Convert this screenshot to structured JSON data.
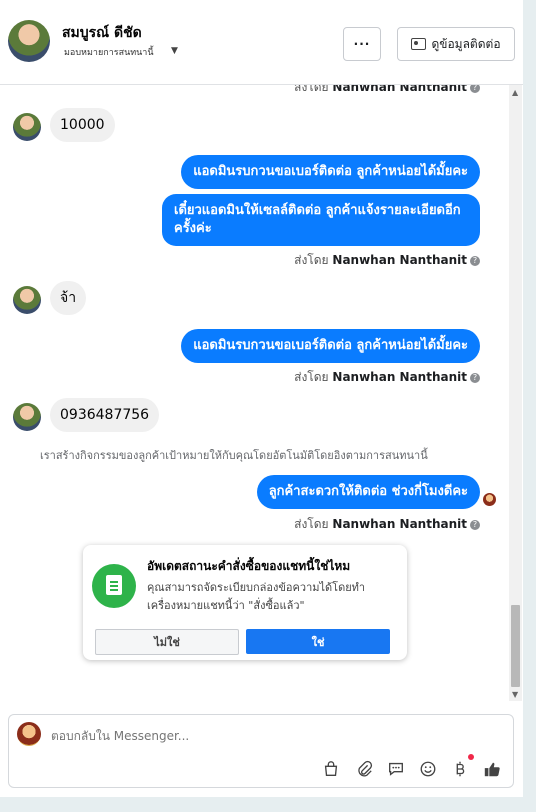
{
  "header": {
    "contact_name": "สมบูรณ์ ดีชัด",
    "assign_label": "มอบหมายการสนทนานี้",
    "more_label": "···",
    "view_contact_label": "ดูข้อมูลติดต่อ"
  },
  "messages": {
    "sent_by_prefix": "ส่งโดย",
    "agent_name": "Nanwhan Nanthanit",
    "info_glyph": "?",
    "in1": "10000",
    "out1": "แอดมินรบกวนขอเบอร์ติดต่อ ลูกค้าหน่อยได้มั้ยคะ",
    "out2": "เดี๋ยวแอดมินให้เซลล์ติดต่อ ลูกค้าแจ้งรายละเอียดอีกครั้งค่ะ",
    "in2": "จ้า",
    "out3": "แอดมินรบกวนขอเบอร์ติดต่อ ลูกค้าหน่อยได้มั้ยคะ",
    "in3": "0936487756",
    "system_note": "เราสร้างกิจกรรมของลูกค้าเป้าหมายให้กับคุณโดยอัตโนมัติโดยอิงตามการสนทนานี้",
    "out4": "ลูกค้าสะดวกให้ติดต่อ ช่วงกี่โมงดีคะ"
  },
  "order_card": {
    "title": "อัพเดตสถานะคำสั่งซื้อของแชทนี้ใช่ไหม",
    "description": "คุณสามารถจัดระเบียบกล่องข้อความได้โดยทำเครื่องหมายแชทนี้ว่า \"สั่งซื้อแล้ว\"",
    "no_label": "ไม่ใช่",
    "yes_label": "ใช่"
  },
  "composer": {
    "placeholder": "ตอบกลับใน Messenger...",
    "tools": [
      "shopping-bag-icon",
      "paperclip-icon",
      "saved-reply-icon",
      "emoji-icon",
      "baht-payment-icon",
      "thumbs-up-icon"
    ]
  },
  "colors": {
    "accent": "#0a7cff",
    "primary_button": "#1877f2",
    "order_icon": "#2eb34a",
    "notification_dot": "#f02849"
  }
}
